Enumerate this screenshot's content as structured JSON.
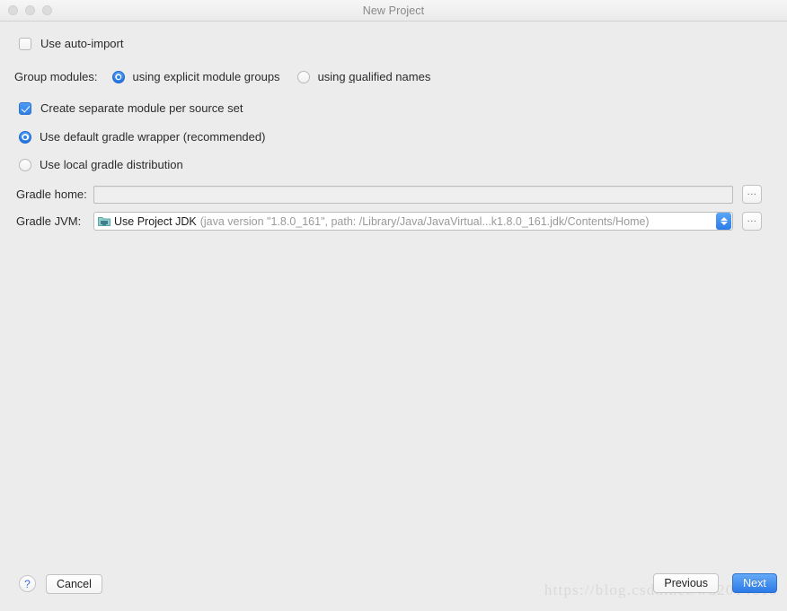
{
  "window": {
    "title": "New Project",
    "traffic_lights": [
      "close",
      "minimize",
      "maximize"
    ]
  },
  "form": {
    "auto_import": {
      "label": "Use auto-import",
      "checked": false
    },
    "group_modules": {
      "label": "Group modules:",
      "options": [
        {
          "label_prefix": "using explicit module ",
          "mnemonic": "g",
          "label_suffix": "roups",
          "selected": true
        },
        {
          "label_prefix": "using ",
          "mnemonic": "q",
          "label_suffix": "ualified names",
          "selected": false
        }
      ]
    },
    "separate_module": {
      "label": "Create separate module per source set",
      "checked": true
    },
    "gradle_wrapper": {
      "label": "Use default gradle wrapper (recommended)",
      "selected": true
    },
    "local_distribution": {
      "label": "Use local gradle distribution",
      "selected": false
    },
    "gradle_home": {
      "label": "Gradle home:",
      "value": "",
      "placeholder": "",
      "browse_label": "..."
    },
    "gradle_jvm": {
      "label": "Gradle JVM:",
      "icon": "jdk-icon",
      "value_primary": "Use Project JDK",
      "value_secondary": "(java version \"1.8.0_161\", path: /Library/Java/JavaVirtual...k1.8.0_161.jdk/Contents/Home)",
      "browse_label": "..."
    }
  },
  "footer": {
    "help_label": "?",
    "cancel_label": "Cancel",
    "previous_label": "Previous",
    "next_label": "Next"
  },
  "watermark": {
    "text": "https://blog.csdn.net/wd2014610"
  },
  "colors": {
    "accent": "#2c7ae6",
    "window_bg": "#ececec",
    "title_text": "#8a8a8a",
    "secondary_text": "#9a9a9a",
    "watermark": "#d9d9d9"
  }
}
